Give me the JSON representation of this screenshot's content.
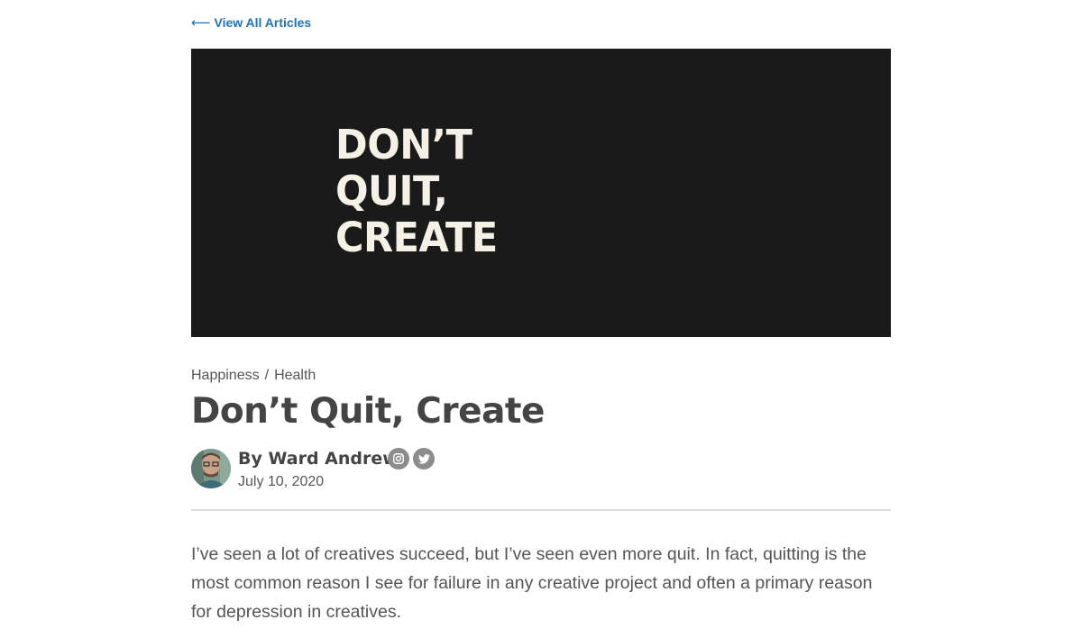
{
  "nav": {
    "back_arrow": "⟵",
    "back_label": "View All Articles"
  },
  "hero": {
    "text": "DON’T\nQUIT,\nCREATE"
  },
  "article": {
    "categories": [
      "Happiness",
      "Health"
    ],
    "separator": "/",
    "title": "Don’t Quit, Create",
    "author": "By Ward Andrews",
    "date": "July 10, 2020",
    "social": [
      "instagram-icon",
      "twitter-icon"
    ],
    "body": "I’ve seen a lot of creatives succeed, but I’ve seen even more quit. In fact, quitting is the most common reason I see for failure in any creative project and often a primary reason for depression in creatives."
  },
  "colors": {
    "link": "#1f73b7",
    "hero_background": "#1a1a1a",
    "hero_text": "#f6f1e6",
    "heading": "#444444",
    "body_text": "#555555",
    "divider": "#dddddd",
    "social_icon_bg": "#8c8c8c"
  }
}
